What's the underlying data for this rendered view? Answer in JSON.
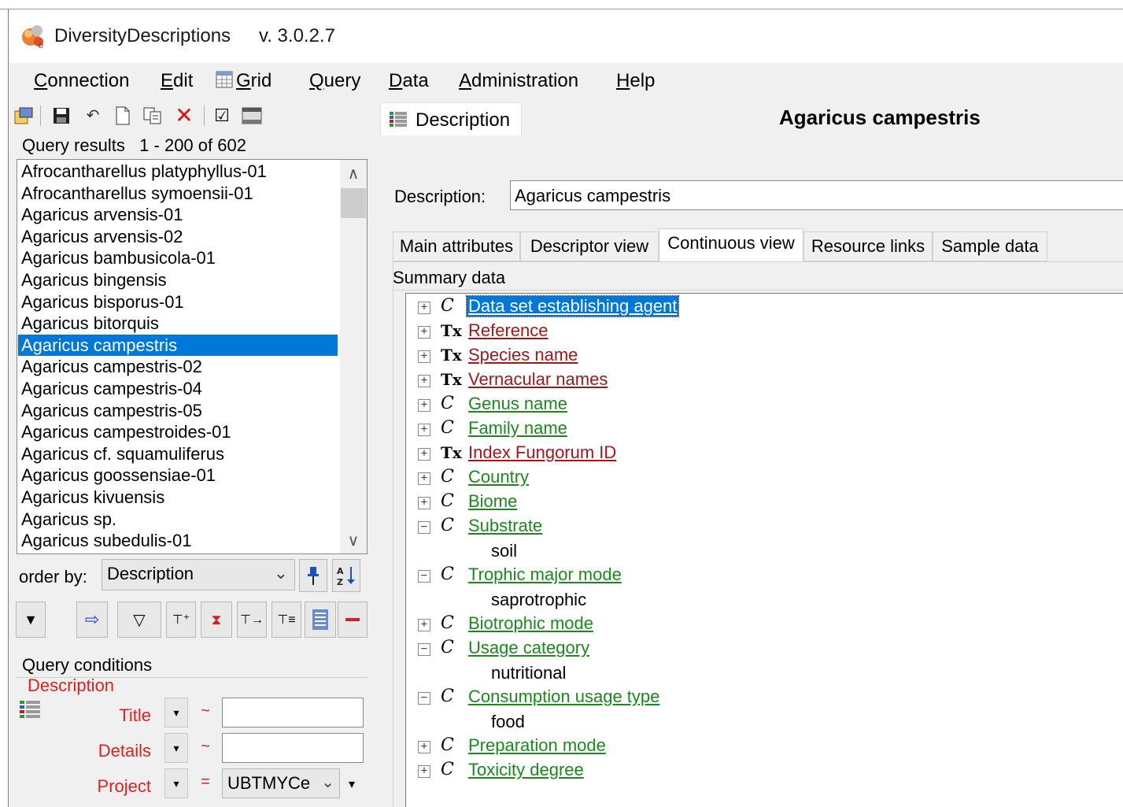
{
  "app": {
    "title": "DiversityDescriptions",
    "version": "v. 3.0.2.7"
  },
  "menu": {
    "connection": {
      "hot": "C",
      "rest": "onnection"
    },
    "edit": {
      "hot": "E",
      "rest": "dit"
    },
    "grid": {
      "hot": "G",
      "rest": "rid"
    },
    "query": {
      "hot": "Q",
      "rest": "uery"
    },
    "data": {
      "hot": "D",
      "rest": "ata"
    },
    "administration": {
      "hot": "A",
      "rest": "dministration"
    },
    "help": {
      "hot": "H",
      "rest": "elp"
    }
  },
  "query_results": {
    "label": "Query results",
    "range": "1 - 200 of 602",
    "items": [
      "Afrocantharellus platyphyllus-01",
      "Afrocantharellus symoensii-01",
      "Agaricus arvensis-01",
      "Agaricus arvensis-02",
      "Agaricus bambusicola-01",
      "Agaricus bingensis",
      "Agaricus bisporus-01",
      "Agaricus bitorquis",
      "Agaricus campestris",
      "Agaricus campestris-02",
      "Agaricus campestris-04",
      "Agaricus campestris-05",
      "Agaricus campestroides-01",
      "Agaricus cf. squamuliferus",
      "Agaricus goossensiae-01",
      "Agaricus kivuensis",
      "Agaricus sp.",
      "Agaricus subedulis-01"
    ],
    "selected_index": 8
  },
  "order_by": {
    "label": "order by:",
    "value": "Description"
  },
  "query_conditions": {
    "label": "Query conditions",
    "group": "Description",
    "fields": [
      {
        "label": "Title",
        "op": "~",
        "value": ""
      },
      {
        "label": "Details",
        "op": "~",
        "value": ""
      },
      {
        "label": "Project",
        "op": "=",
        "value": "UBTMYCe"
      }
    ]
  },
  "detail": {
    "tab_label": "Description",
    "header_title": "Agaricus campestris",
    "description_label": "Description:",
    "description_value": "Agaricus campestris",
    "tabs": [
      "Main attributes",
      "Descriptor view",
      "Continuous view",
      "Resource links",
      "Sample data"
    ],
    "active_tab": 2,
    "summary_label": "Summary data",
    "tree": [
      {
        "type": "C",
        "label": "Data set establishing agent",
        "color": "green",
        "expanded": false,
        "selected": true
      },
      {
        "type": "Tx",
        "label": "Reference",
        "color": "red",
        "expanded": false
      },
      {
        "type": "Tx",
        "label": "Species name",
        "color": "red",
        "expanded": false
      },
      {
        "type": "Tx",
        "label": "Vernacular names",
        "color": "red",
        "expanded": false
      },
      {
        "type": "C",
        "label": "Genus name",
        "color": "green",
        "expanded": false
      },
      {
        "type": "C",
        "label": "Family name",
        "color": "green",
        "expanded": false
      },
      {
        "type": "Tx",
        "label": "Index Fungorum ID",
        "color": "red",
        "expanded": false
      },
      {
        "type": "C",
        "label": "Country",
        "color": "green",
        "expanded": false
      },
      {
        "type": "C",
        "label": "Biome",
        "color": "green",
        "expanded": false
      },
      {
        "type": "C",
        "label": "Substrate",
        "color": "green",
        "expanded": true,
        "value": "soil"
      },
      {
        "type": "C",
        "label": "Trophic major mode",
        "color": "green",
        "expanded": true,
        "value": "saprotrophic"
      },
      {
        "type": "C",
        "label": "Biotrophic mode",
        "color": "green",
        "expanded": false
      },
      {
        "type": "C",
        "label": "Usage category",
        "color": "green",
        "expanded": true,
        "value": "nutritional"
      },
      {
        "type": "C",
        "label": "Consumption usage type",
        "color": "green",
        "expanded": true,
        "value": "food"
      },
      {
        "type": "C",
        "label": "Preparation mode",
        "color": "green",
        "expanded": false
      },
      {
        "type": "C",
        "label": "Toxicity degree",
        "color": "green",
        "expanded": false
      }
    ]
  },
  "colors": {
    "selection": "#0078d7",
    "categorical_link": "#1a8a1a",
    "text_link": "#a01818",
    "condition_label": "#e02020"
  }
}
